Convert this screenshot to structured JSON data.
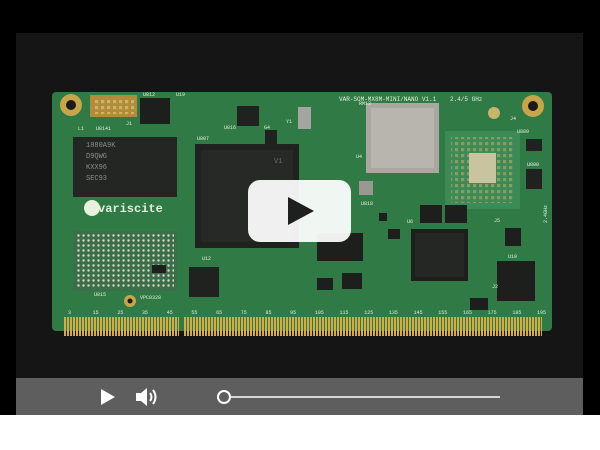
{
  "video": {
    "board": {
      "title": "VAR-SOM-MX8M-MINI/NANO V1.1",
      "wifi": "2.4/5 GHz",
      "brand": "variscite",
      "chip_text": [
        "1880A9K",
        "D9QWG",
        "KXX96",
        "SEC93"
      ],
      "labels": {
        "u812": "U812",
        "u19": "U19",
        "j1": "J1",
        "l1": "L1",
        "u8141": "U8141",
        "u816": "U816",
        "u807": "U807",
        "g4": "G4",
        "y1": "Y1",
        "u4": "U4",
        "rm13": "RM13",
        "j4": "J4",
        "u809": "U809",
        "u800": "U800",
        "v1": "V1",
        "u818": "U818",
        "u6": "U6",
        "u12": "U12",
        "u815": "U815",
        "vpc": "VPC0328",
        "u10": "U10",
        "j5": "J5",
        "j2": "J2",
        "ghz2": "2.4GHz"
      },
      "pin_numbers": [
        "3",
        "15",
        "25",
        "35",
        "45",
        "55",
        "65",
        "75",
        "85",
        "95",
        "105",
        "115",
        "125",
        "135",
        "145",
        "155",
        "165",
        "175",
        "185",
        "195"
      ]
    }
  },
  "controls": {
    "play_icon": "play-icon",
    "volume_icon": "volume-icon",
    "progress": 0
  },
  "colors": {
    "pcb": "#2f7a45",
    "controls_bg": "#5e5e5e",
    "gold": "#c8a23c"
  }
}
